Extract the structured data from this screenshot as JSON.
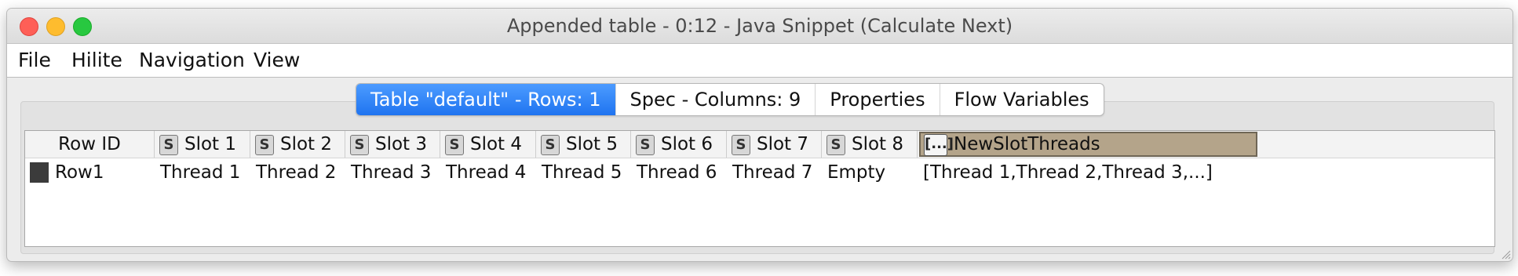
{
  "window": {
    "title": "Appended table - 0:12 - Java Snippet (Calculate Next)"
  },
  "menu": {
    "items": [
      "File",
      "Hilite",
      "Navigation",
      "View"
    ]
  },
  "tabs": [
    {
      "label": "Table \"default\" - Rows: 1",
      "active": true
    },
    {
      "label": "Spec - Columns: 9",
      "active": false
    },
    {
      "label": "Properties",
      "active": false
    },
    {
      "label": "Flow Variables",
      "active": false
    }
  ],
  "table": {
    "headers": {
      "row_id": "Row ID",
      "string_badge": "S",
      "list_badge": "[...]",
      "columns": [
        "Slot 1",
        "Slot 2",
        "Slot 3",
        "Slot 4",
        "Slot 5",
        "Slot 6",
        "Slot 7",
        "Slot 8",
        "NewSlotThreads"
      ]
    },
    "rows": [
      {
        "id": "Row1",
        "cells": [
          "Thread 1",
          "Thread 2",
          "Thread 3",
          "Thread 4",
          "Thread 5",
          "Thread 6",
          "Thread 7",
          "Empty",
          "[Thread 1,Thread 2,Thread 3,...]"
        ]
      }
    ]
  },
  "colors": {
    "active_tab": "#1f74f0",
    "selected_header": "#b4a48a",
    "close": "#fe5f57",
    "minimize": "#febc2e",
    "maximize": "#28c840"
  }
}
